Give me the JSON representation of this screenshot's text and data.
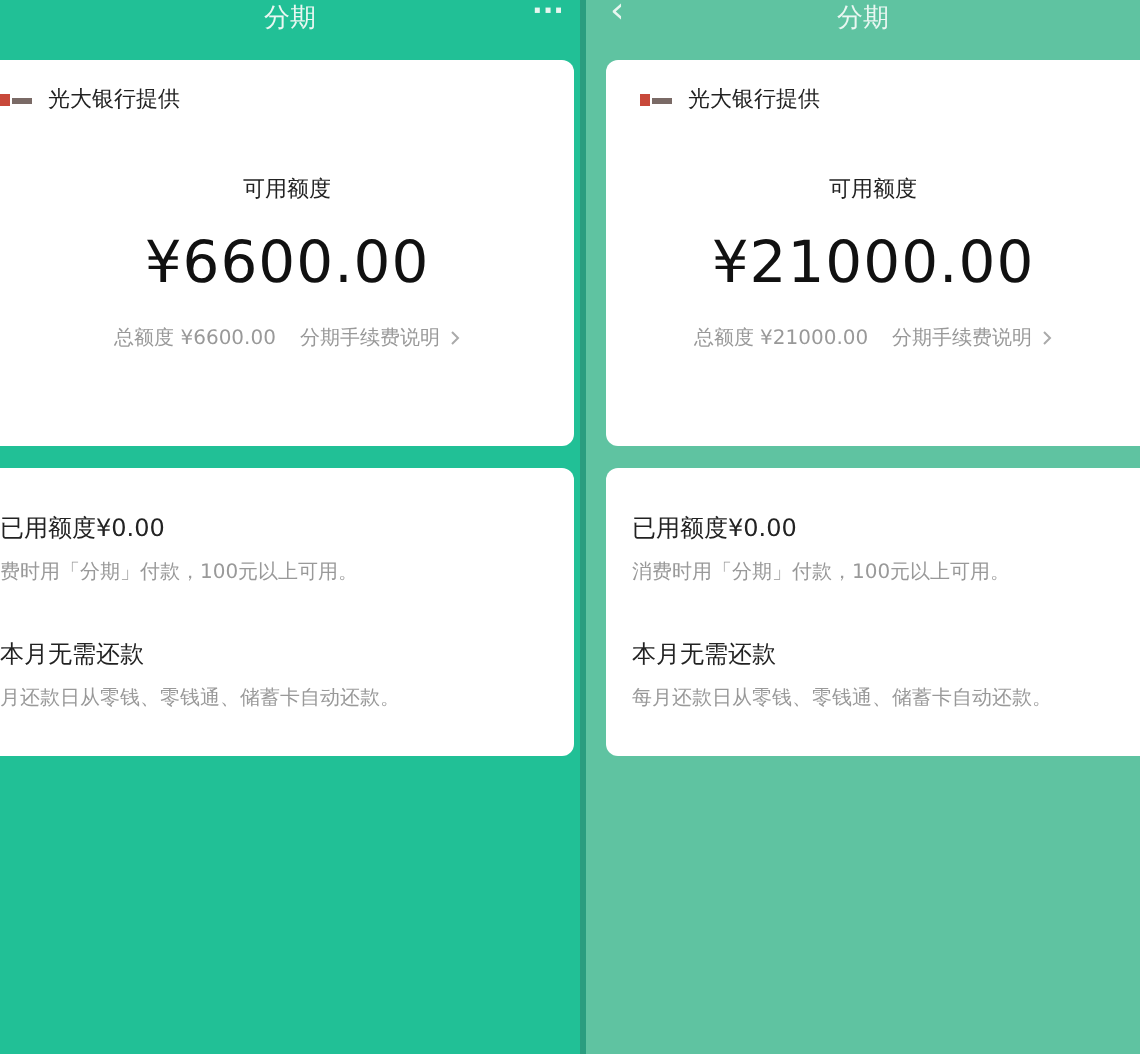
{
  "panels": [
    {
      "header": {
        "title": "分期",
        "control": "···"
      },
      "provider": "光大银行提供",
      "available_label": "可用额度",
      "amount": "¥6600.00",
      "total": "总额度 ¥6600.00",
      "fee_link": "分期手续费说明",
      "used_title": "已用额度¥0.00",
      "used_desc": "费时用「分期」付款，100元以上可用。",
      "repay_title": "本月无需还款",
      "repay_desc": "月还款日从零钱、零钱通、储蓄卡自动还款。"
    },
    {
      "header": {
        "title": "分期",
        "control": "‹"
      },
      "provider": "光大银行提供",
      "available_label": "可用额度",
      "amount": "¥21000.00",
      "total": "总额度 ¥21000.00",
      "fee_link": "分期手续费说明",
      "used_title": "已用额度¥0.00",
      "used_desc": "消费时用「分期」付款，100元以上可用。",
      "repay_title": "本月无需还款",
      "repay_desc": "每月还款日从零钱、零钱通、储蓄卡自动还款。"
    }
  ]
}
